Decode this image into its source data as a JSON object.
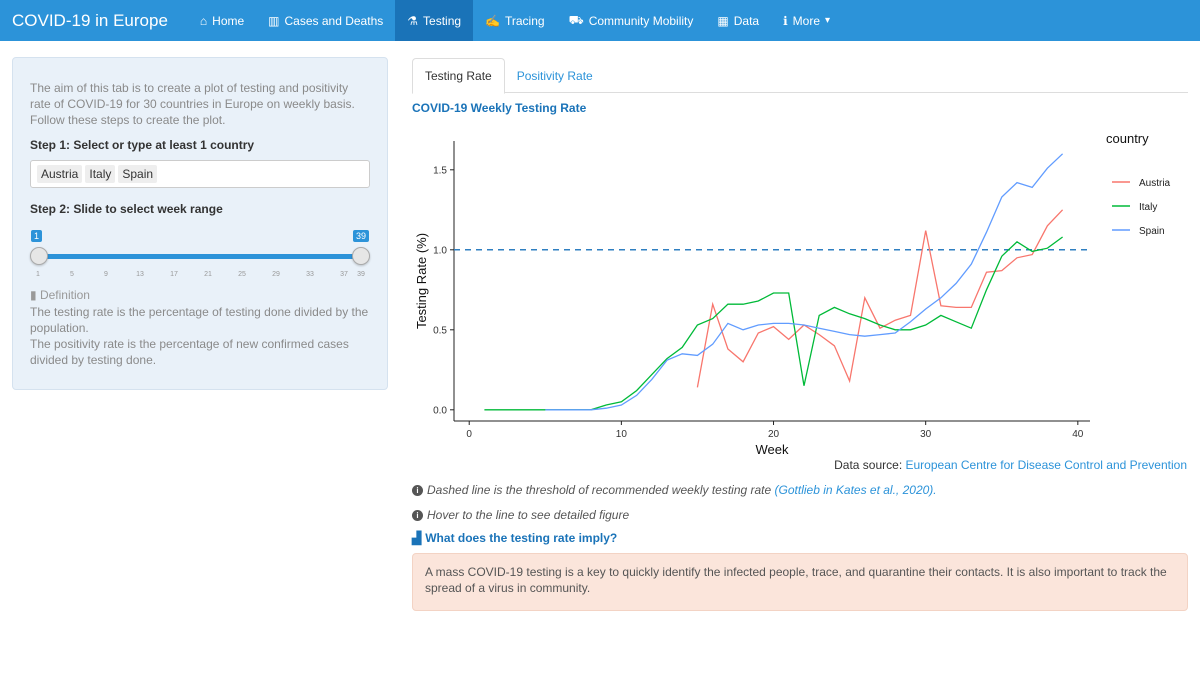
{
  "navbar": {
    "brand": "COVID-19 in Europe",
    "items": [
      {
        "label": "Home",
        "icon": "home-icon",
        "glyph": "⌂"
      },
      {
        "label": "Cases and Deaths",
        "icon": "bar-chart-icon",
        "glyph": "▥"
      },
      {
        "label": "Testing",
        "icon": "test-tube-icon",
        "glyph": "⚗"
      },
      {
        "label": "Tracing",
        "icon": "tracing-icon",
        "glyph": "✍"
      },
      {
        "label": "Community Mobility",
        "icon": "car-icon",
        "glyph": "⛟"
      },
      {
        "label": "Data",
        "icon": "table-icon",
        "glyph": "▦"
      },
      {
        "label": "More",
        "icon": "info-icon",
        "glyph": "ℹ",
        "caret": "▾"
      }
    ],
    "active": "Testing"
  },
  "sidebar": {
    "intro": "The aim of this tab is to create a plot of testing and positivity rate of COVID-19 for 30 countries in Europe on weekly basis. Follow these steps to create the plot.",
    "step1_label": "Step 1: Select or type at least 1 country",
    "selected_countries": [
      "Austria",
      "Italy",
      "Spain"
    ],
    "step2_label": "Step 2: Slide to select week range",
    "slider": {
      "min": 1,
      "max": 39,
      "from": 1,
      "to": 39,
      "from_label": "1",
      "to_label": "39",
      "ticks": [
        "1",
        "5",
        "9",
        "13",
        "17",
        "21",
        "25",
        "29",
        "33",
        "37",
        "39"
      ]
    },
    "definition_head": "Definition",
    "definition_line1": "The testing rate is the percentage of testing done divided by the population.",
    "definition_line2": "The positivity rate is the percentage of new confirmed cases divided by testing done."
  },
  "tabs": [
    {
      "label": "Testing Rate",
      "active": true
    },
    {
      "label": "Positivity Rate",
      "active": false
    }
  ],
  "chart_title": "COVID-19 Weekly Testing Rate",
  "chart_data": {
    "type": "line",
    "title": "",
    "xlabel": "Week",
    "ylabel": "Testing Rate (%)",
    "xlim": [
      -1,
      40.8
    ],
    "ylim": [
      -0.07,
      1.68
    ],
    "xticks": [
      0,
      10,
      20,
      30,
      40
    ],
    "yticks": [
      0.0,
      0.5,
      1.0,
      1.5
    ],
    "ytick_labels": [
      "0.0",
      "0.5",
      "1.0",
      "1.5"
    ],
    "threshold": 1.0,
    "legend_title": "country",
    "legend_position": "top-right",
    "series": [
      {
        "name": "Austria",
        "color": "#f8766d",
        "x": [
          15,
          16,
          17,
          18,
          19,
          20,
          21,
          22,
          23,
          24,
          25,
          26,
          27,
          28,
          29,
          30,
          31,
          32,
          33,
          34,
          35,
          36,
          37,
          38,
          39
        ],
        "y": [
          0.14,
          0.66,
          0.38,
          0.3,
          0.48,
          0.52,
          0.44,
          0.53,
          0.47,
          0.4,
          0.18,
          0.7,
          0.51,
          0.56,
          0.59,
          1.12,
          0.65,
          0.64,
          0.64,
          0.86,
          0.87,
          0.95,
          0.97,
          1.15,
          1.25
        ]
      },
      {
        "name": "Italy",
        "color": "#00ba38",
        "x": [
          1,
          2,
          3,
          4,
          5,
          6,
          7,
          8,
          9,
          10,
          11,
          12,
          13,
          14,
          15,
          16,
          17,
          18,
          19,
          20,
          21,
          22,
          23,
          24,
          25,
          26,
          27,
          28,
          29,
          30,
          31,
          32,
          33,
          34,
          35,
          36,
          37,
          38,
          39
        ],
        "y": [
          0.0,
          0.0,
          0.0,
          0.0,
          0.0,
          0.0,
          0.0,
          0.0,
          0.03,
          0.05,
          0.12,
          0.22,
          0.32,
          0.39,
          0.53,
          0.57,
          0.66,
          0.66,
          0.68,
          0.73,
          0.73,
          0.15,
          0.59,
          0.64,
          0.6,
          0.57,
          0.53,
          0.5,
          0.5,
          0.53,
          0.59,
          0.55,
          0.51,
          0.75,
          0.96,
          1.05,
          0.99,
          1.01,
          1.08
        ]
      },
      {
        "name": "Spain",
        "color": "#619cff",
        "x": [
          5,
          6,
          7,
          8,
          9,
          10,
          11,
          12,
          13,
          14,
          15,
          16,
          17,
          18,
          19,
          20,
          21,
          22,
          23,
          24,
          25,
          26,
          27,
          28,
          29,
          30,
          31,
          32,
          33,
          34,
          35,
          36,
          37,
          38,
          39
        ],
        "y": [
          0.0,
          0.0,
          0.0,
          0.0,
          0.01,
          0.03,
          0.09,
          0.19,
          0.31,
          0.35,
          0.34,
          0.41,
          0.54,
          0.5,
          0.53,
          0.54,
          0.54,
          0.53,
          0.51,
          0.49,
          0.47,
          0.46,
          0.47,
          0.48,
          0.55,
          0.63,
          0.7,
          0.79,
          0.91,
          1.11,
          1.33,
          1.42,
          1.39,
          1.51,
          1.6
        ]
      }
    ]
  },
  "source": {
    "prefix": "Data source: ",
    "link": "European Centre for Disease Control and Prevention"
  },
  "note1": {
    "text": "Dashed line is the threshold of recommended weekly testing rate ",
    "link": "(Gottlieb in Kates et al., 2020).",
    "icon_glyph": "i"
  },
  "note2": {
    "text": "Hover to the line to see detailed figure",
    "icon_glyph": "i"
  },
  "collapse": {
    "label": "What does the testing rate imply?",
    "icon_glyph": "▟"
  },
  "callout": "A mass COVID-19 testing is a key to quickly identify the infected people, trace, and quarantine their contacts. It is also important to track the spread of a virus in community.",
  "colors": {
    "navbar": "#2c93d9",
    "navbar_active": "#1a73b8",
    "link": "#2c93d9",
    "callout_bg": "#fbe5db",
    "threshold": "#2f7fc1"
  }
}
